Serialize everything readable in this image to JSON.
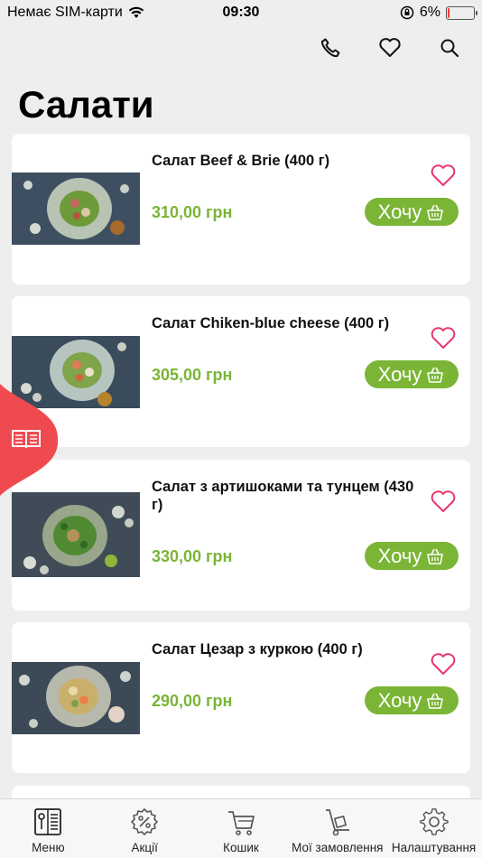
{
  "status": {
    "carrier": "Немає SIM-карти",
    "time": "09:30",
    "battery": "6%",
    "battery_level": 0.06
  },
  "header": {
    "title": "Салати",
    "icons": [
      "phone-icon",
      "heart-icon",
      "search-icon"
    ]
  },
  "products": [
    {
      "name": "Салат Beef & Brie (400 г)",
      "price": "310,00 грн",
      "button": "Хочу",
      "plate_color": "#b9c3b4"
    },
    {
      "name": "Салат Chiken-blue cheese (400 г)",
      "price": "305,00 грн",
      "button": "Хочу",
      "plate_color": "#b7c5c1"
    },
    {
      "name": "Салат з артишоками та тунцем (430 г)",
      "price": "330,00 грн",
      "button": "Хочу",
      "plate_color": "#9aa68c"
    },
    {
      "name": "Салат Цезар з куркою (400 г)",
      "price": "290,00 грн",
      "button": "Хочу",
      "plate_color": "#b8b9ad"
    }
  ],
  "tabs": [
    {
      "label": "Меню",
      "icon": "menu-book-icon"
    },
    {
      "label": "Акції",
      "icon": "discount-gear-icon"
    },
    {
      "label": "Кошик",
      "icon": "cart-icon"
    },
    {
      "label": "Мої замовлення",
      "icon": "orders-dolly-icon"
    },
    {
      "label": "Налаштування",
      "icon": "settings-gear-icon"
    }
  ],
  "colors": {
    "accent_green": "#7ab535",
    "heart_pink": "#e8386b",
    "flag_red": "#ef4a50",
    "background": "#eeeeee"
  }
}
